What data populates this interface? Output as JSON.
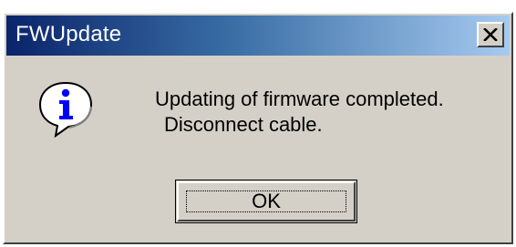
{
  "window": {
    "title": "FWUpdate",
    "titlebar_colors": [
      "#0a246a",
      "#a6caf0"
    ],
    "close_icon": "close-x-icon"
  },
  "message": {
    "icon": "information-icon",
    "line1": "Updating of firmware completed.",
    "line2": "Disconnect cable."
  },
  "buttons": {
    "ok_label": "OK"
  }
}
